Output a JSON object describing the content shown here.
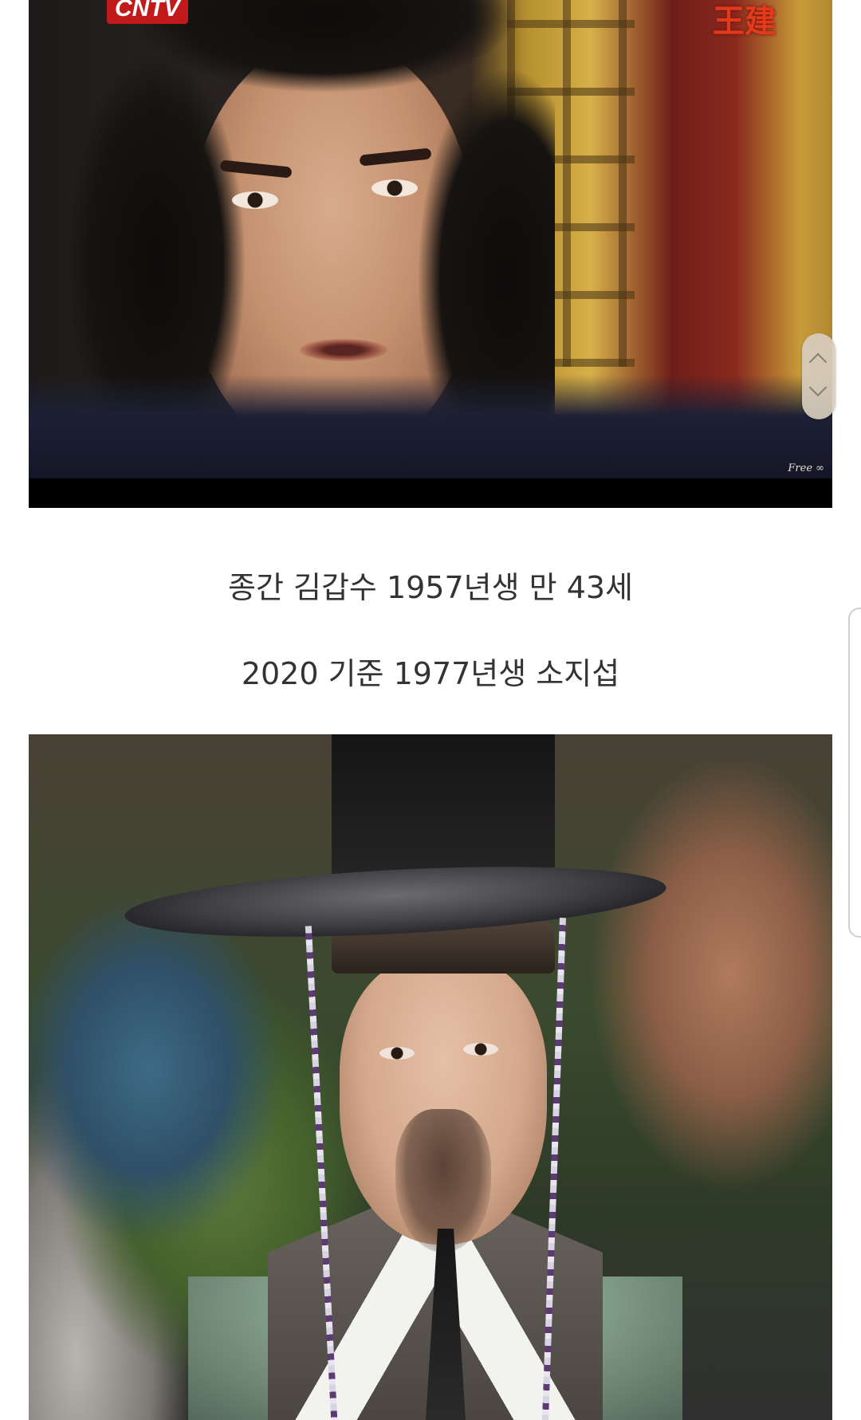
{
  "top_image": {
    "channel_logo": "CNTV",
    "corner_text": "王建",
    "watermark": "Free ∞"
  },
  "captions": {
    "line1": "종간 김갑수 1957년생 만 43세",
    "line2": "2020 기준 1977년생 소지섭"
  },
  "scroll_indicator": {
    "up_icon": "chevron-up-icon",
    "down_icon": "chevron-down-icon"
  },
  "colors": {
    "caption_text": "#333333",
    "page_background": "#ffffff",
    "logo_red": "#c21a1a"
  }
}
